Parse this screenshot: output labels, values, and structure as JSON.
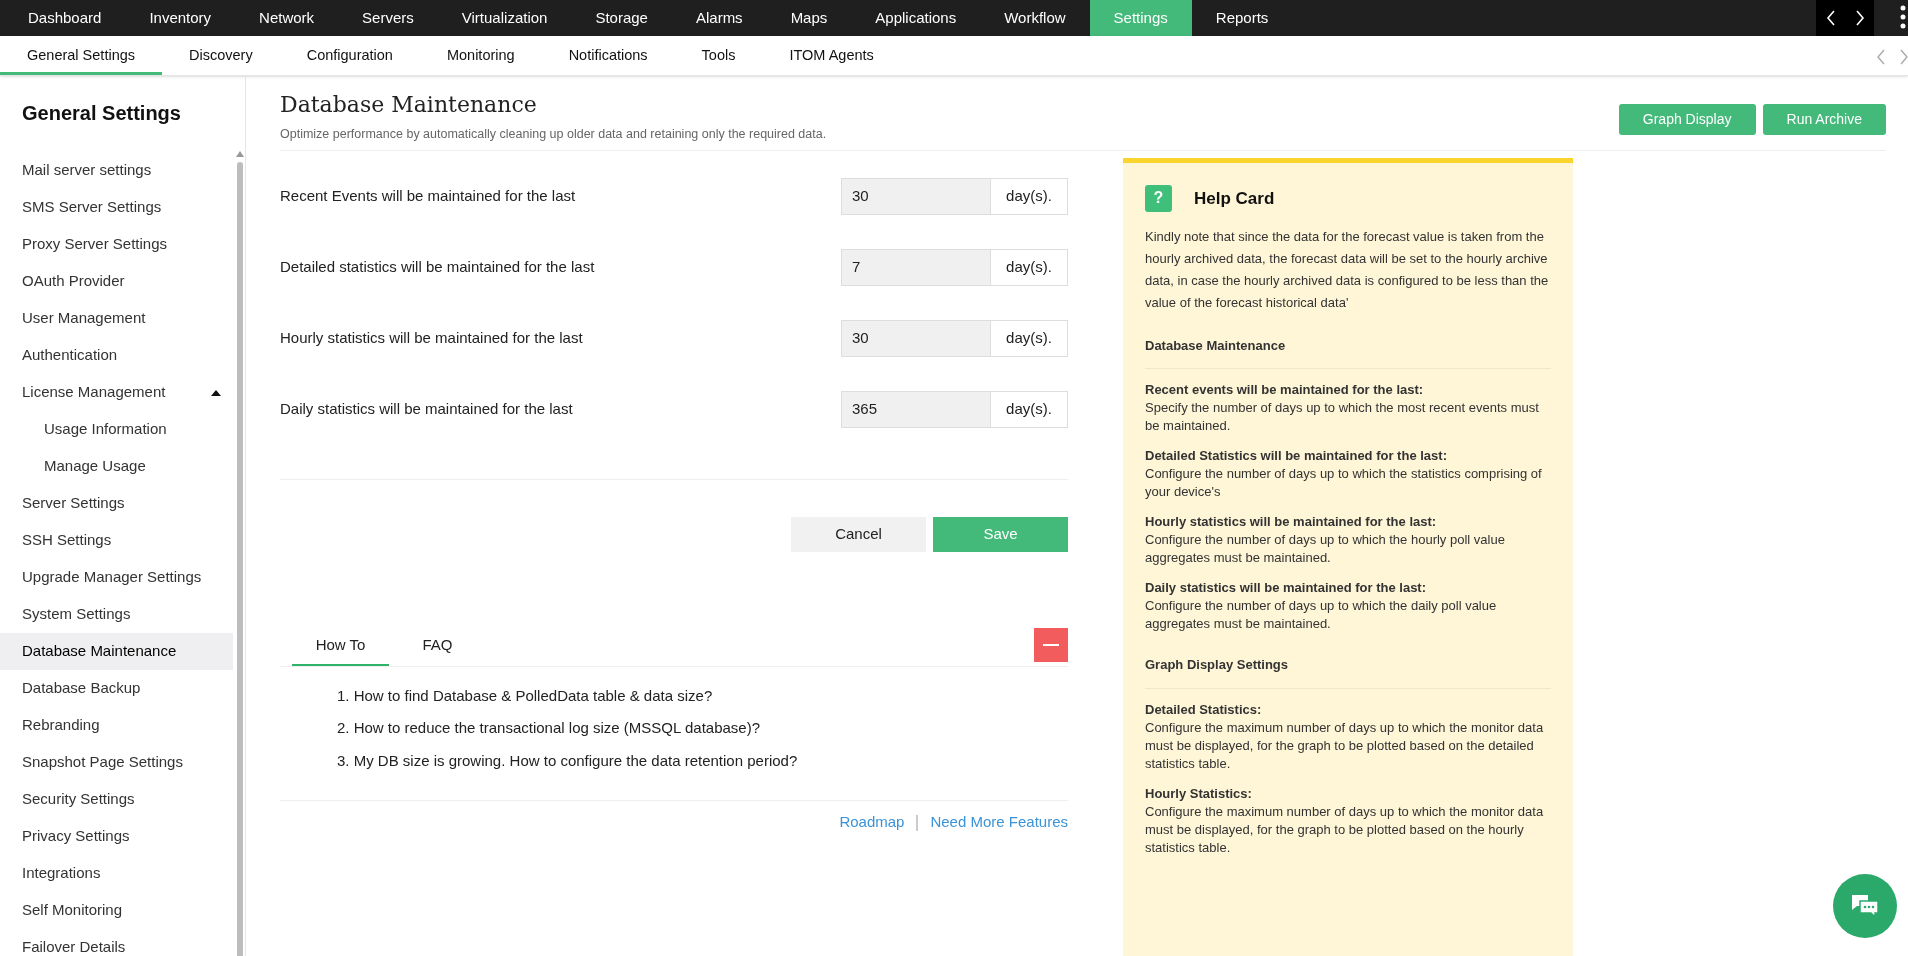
{
  "top_nav": [
    {
      "label": "Dashboard",
      "selected": false
    },
    {
      "label": "Inventory",
      "selected": false
    },
    {
      "label": "Network",
      "selected": false
    },
    {
      "label": "Servers",
      "selected": false
    },
    {
      "label": "Virtualization",
      "selected": false
    },
    {
      "label": "Storage",
      "selected": false
    },
    {
      "label": "Alarms",
      "selected": false
    },
    {
      "label": "Maps",
      "selected": false
    },
    {
      "label": "Applications",
      "selected": false
    },
    {
      "label": "Workflow",
      "selected": false
    },
    {
      "label": "Settings",
      "selected": true
    },
    {
      "label": "Reports",
      "selected": false
    }
  ],
  "sub_nav": [
    {
      "label": "General Settings",
      "selected": true
    },
    {
      "label": "Discovery",
      "selected": false
    },
    {
      "label": "Configuration",
      "selected": false
    },
    {
      "label": "Monitoring",
      "selected": false
    },
    {
      "label": "Notifications",
      "selected": false
    },
    {
      "label": "Tools",
      "selected": false
    },
    {
      "label": "ITOM Agents",
      "selected": false
    }
  ],
  "sidebar": {
    "title": "General Settings",
    "items": [
      {
        "label": "Mail server settings",
        "selected": false
      },
      {
        "label": "SMS Server Settings",
        "selected": false
      },
      {
        "label": "Proxy Server Settings",
        "selected": false
      },
      {
        "label": "OAuth Provider",
        "selected": false
      },
      {
        "label": "User Management",
        "selected": false
      },
      {
        "label": "Authentication",
        "selected": false
      },
      {
        "label": "License Management",
        "selected": false,
        "expanded": true,
        "children": [
          {
            "label": "Usage Information",
            "selected": false
          },
          {
            "label": "Manage Usage",
            "selected": false
          }
        ]
      },
      {
        "label": "Server Settings",
        "selected": false
      },
      {
        "label": "SSH Settings",
        "selected": false
      },
      {
        "label": "Upgrade Manager Settings",
        "selected": false
      },
      {
        "label": "System Settings",
        "selected": false
      },
      {
        "label": "Database Maintenance",
        "selected": true
      },
      {
        "label": "Database Backup",
        "selected": false
      },
      {
        "label": "Rebranding",
        "selected": false
      },
      {
        "label": "Snapshot Page Settings",
        "selected": false
      },
      {
        "label": "Security Settings",
        "selected": false
      },
      {
        "label": "Privacy Settings",
        "selected": false
      },
      {
        "label": "Integrations",
        "selected": false
      },
      {
        "label": "Self Monitoring",
        "selected": false
      },
      {
        "label": "Failover Details",
        "selected": false
      }
    ]
  },
  "page": {
    "title": "Database Maintenance",
    "subtitle": "Optimize performance by automatically cleaning up older data and retaining only the required data.",
    "actions": [
      "Graph Display",
      "Run Archive"
    ]
  },
  "settings": [
    {
      "label": "Recent Events will be maintained for the last",
      "value": "30",
      "unit": "day(s)."
    },
    {
      "label": "Detailed statistics will be maintained for the last",
      "value": "7",
      "unit": "day(s)."
    },
    {
      "label": "Hourly statistics will be maintained for the last",
      "value": "30",
      "unit": "day(s)."
    },
    {
      "label": "Daily statistics will be maintained for the last",
      "value": "365",
      "unit": "day(s)."
    }
  ],
  "form_buttons": {
    "cancel": "Cancel",
    "save": "Save"
  },
  "help_tabs": [
    {
      "label": "How To",
      "selected": true
    },
    {
      "label": "FAQ",
      "selected": false
    }
  ],
  "how_to": [
    "1. How to find Database & PolledData table & data size?",
    "2. How to reduce the transactional log size (MSSQL database)?",
    "3. My DB size is growing. How to configure the data retention period?"
  ],
  "links": [
    "Roadmap",
    "Need More Features"
  ],
  "help_card": {
    "icon": "?",
    "title": "Help Card",
    "intro": "Kindly note that since the data for the forecast value is taken from the hourly archived data, the forecast data will be set to the hourly archive data, in case the hourly archived data is configured to be less than the value of the forecast historical data'",
    "sections": [
      {
        "heading": "Database Maintenance",
        "items": [
          {
            "term": "Recent events will be maintained for the last:",
            "description": "Specify the number of days up to which the most recent events must be maintained."
          },
          {
            "term": "Detailed Statistics will be maintained for the last:",
            "description": "Configure the number of days up to which the statistics comprising of your device's"
          },
          {
            "term": "Hourly statistics will be maintained for the last:",
            "description": "Configure the number of days up to which the hourly poll value aggregates must be maintained."
          },
          {
            "term": "Daily statistics will be maintained for the last:",
            "description": "Configure the number of days up to which the daily poll value aggregates must be maintained."
          }
        ]
      },
      {
        "heading": "Graph Display Settings",
        "items": [
          {
            "term": "Detailed Statistics:",
            "description": "Configure the maximum number of days up to which the monitor data must be displayed, for the graph to be plotted based on the detailed statistics table."
          },
          {
            "term": "Hourly Statistics:",
            "description": "Configure the maximum number of days up to which the monitor data must be displayed, for the graph to be plotted based on the hourly statistics table."
          }
        ]
      }
    ]
  }
}
